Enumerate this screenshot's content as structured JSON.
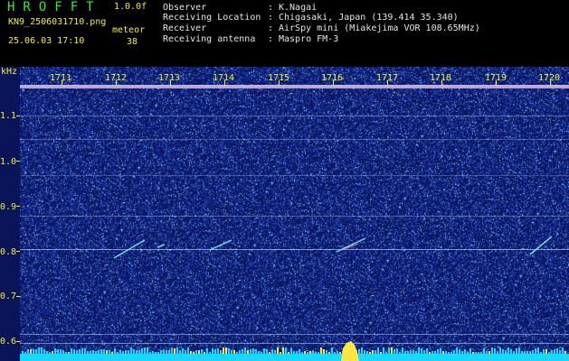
{
  "header": {
    "logo": "HROFFT",
    "version": "1.0.0f",
    "filename": "KN9_2506031710.png",
    "meteor_label": "meteor",
    "timestamp": "25.06.03 17:10",
    "meteor_count": "38",
    "info": [
      {
        "label": "Observer",
        "value": "K.Nagai"
      },
      {
        "label": "Receiving Location",
        "value": "Chigasaki, Japan (139.414 35.340)"
      },
      {
        "label": "Receiver",
        "value": "AirSpy mini (Miakejima VOR 108.65MHz)"
      },
      {
        "label": "Receiving antenna",
        "value": "Maspro FM-3"
      }
    ]
  },
  "plot": {
    "y_unit": "kHz",
    "y_ticks": [
      "1.1",
      "1.0",
      "0.9",
      "0.8",
      "0.7",
      "0.6"
    ],
    "x_ticks": [
      "1711",
      "1712",
      "1713",
      "1714",
      "1715",
      "1716",
      "1717",
      "1718",
      "1719",
      "1720"
    ],
    "colors": {
      "background": "#0a1458",
      "label": "#f2ee3a",
      "signal": "#7df0e6",
      "bar": "#18d8ff"
    }
  }
}
